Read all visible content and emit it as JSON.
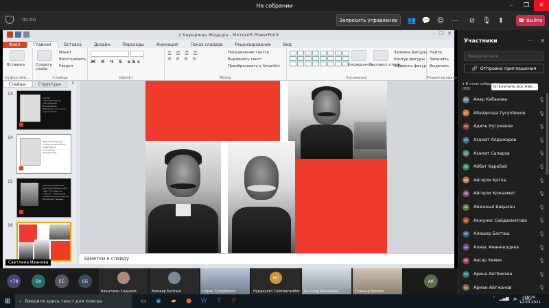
{
  "teams": {
    "title": "На собрании",
    "timer": "00:00",
    "request_control": "Запросить управление",
    "leave": "Выйти",
    "toolbar_icons": [
      "people-icon",
      "chat-icon",
      "reactions-icon",
      "more-icon",
      "camera-off-icon",
      "mic-off-icon",
      "share-icon"
    ]
  },
  "ppt": {
    "window_title": "2 Бауыржан Жадыра - Microsoft PowerPoint",
    "tabs": [
      "Файл",
      "Главная",
      "Вставка",
      "Дизайн",
      "Переходы",
      "Анимация",
      "Показ слайдов",
      "Рецензирование",
      "Вид"
    ],
    "active_tab": "Главная",
    "ribbon": {
      "clipboard": {
        "paste": "Вставить",
        "label": "Буфер обм..."
      },
      "slides": {
        "new_slide": "Создать слайд",
        "layout": "Макет",
        "reset": "Восстановить",
        "section": "Раздел",
        "label": "Слайды"
      },
      "font": {
        "label": "Шрифт"
      },
      "paragraph": {
        "text_direction": "Направление текста",
        "align_text": "Выровнять текст",
        "smartart": "Преобразовать в SmartArt",
        "label": "Абзац"
      },
      "drawing": {
        "arrange": "Упорядочить",
        "quick_styles": "Экспресс-стили",
        "fill": "Заливка фигуры",
        "outline": "Контур фигуры",
        "effects": "Эффекты фигур",
        "label": "Рисование"
      },
      "editing": {
        "find": "Найти",
        "replace": "Заменить",
        "select": "Выделить",
        "label": "Редактирование"
      }
    },
    "panel_tabs": [
      "Слайды",
      "Структура"
    ],
    "thumbnails": [
      {
        "num": "13",
        "text": "Анкета собственноручно заполненная Бауыржаном Бейсенова кого его в суде по делу..."
      },
      {
        "num": "14",
        "text": "Приговор Военной коллегии Верховного Суда СССР в отношении Букейханова"
      },
      {
        "num": "15",
        "text": "Алихан Букейханов был расстрелян в 1937 году. Это один из главных, одаренный основателя ре в партии Бутырской тюрьме."
      },
      {
        "num": "16",
        "text": ""
      }
    ],
    "notes_placeholder": "Заметки к слайду",
    "presenter": "Светлана Иванова"
  },
  "participants": {
    "title": "Участники",
    "search_placeholder": "Введите имя",
    "invite": "Отправка приглашения",
    "section": "В этом собрании",
    "count": "(88)",
    "mute_all": "Отключить все мик...",
    "list": [
      {
        "initials": "АК",
        "name": "Анар Кабанова",
        "color": "#6b7b8c"
      },
      {
        "initials": "АТ",
        "name": "Абайдолда Тусупбеков",
        "color": "#c7773a"
      },
      {
        "initials": "АН",
        "name": "Адиль Нугуманов",
        "color": "#8b3a3a"
      },
      {
        "initials": "АА",
        "name": "Азамат Алдажаров",
        "color": "#3a6b8b"
      },
      {
        "initials": "АС",
        "name": "Азамат Сапаров",
        "color": "#4a8b6b"
      },
      {
        "initials": "АК",
        "name": "Айбат Қарабай",
        "color": "#3a8b5a"
      },
      {
        "initials": "АҚ",
        "name": "Айгерім Қатпа",
        "color": "#b07a3a"
      },
      {
        "initials": "АҚ",
        "name": "Айгерім Қожахмет",
        "color": "#8b4a6b"
      },
      {
        "initials": "АБ",
        "name": "Айжаныя Бақыхан",
        "color": "#5a7b3a"
      },
      {
        "initials": "АС",
        "name": "Акжунис Сейдахметова",
        "color": "#a04a2a"
      },
      {
        "initials": "АБ",
        "name": "Алишер Балташ",
        "color": "#3a5a8b"
      },
      {
        "initials": "АА",
        "name": "Алмас Аманкелдиев",
        "color": "#6b4a8b"
      },
      {
        "initials": "АК",
        "name": "Ансар Кемек",
        "color": "#b03a4a"
      },
      {
        "initials": "АА",
        "name": "Арина Айтбекова",
        "color": "#2a7b7b"
      },
      {
        "initials": "АА",
        "name": "Арман Айтжанов",
        "color": "#7b6b3a"
      }
    ]
  },
  "gallery": {
    "extra": "+78",
    "circles": [
      {
        "initials": "ӘХ",
        "color": "#2a6b6b"
      },
      {
        "initials": "ЕС",
        "color": "#555a66"
      },
      {
        "initials": "СБ",
        "color": "#3a4a5a"
      }
    ],
    "tiles": [
      {
        "name": "Бакытжан Садыков",
        "initials": "",
        "style": "avatar"
      },
      {
        "name": "Алишер Балташ",
        "initials": "",
        "style": "avatar"
      },
      {
        "name": "Серик Тулеубеков",
        "initials": "",
        "style": "video"
      },
      {
        "name": "Нурдаулет Сейтмагамбет",
        "initials": "НС",
        "style": "initials"
      },
      {
        "name": "Бахтияр Айжанова",
        "initials": "",
        "style": "video"
      },
      {
        "name": "Гульнар Бекова",
        "initials": "",
        "style": "video2"
      },
      {
        "name": "",
        "initials": "АК",
        "style": "initials-only"
      }
    ]
  },
  "taskbar": {
    "search": "Введите здесь текст для поиска",
    "lang": "ENG",
    "time": "15:20",
    "date": "12.03.2021"
  }
}
